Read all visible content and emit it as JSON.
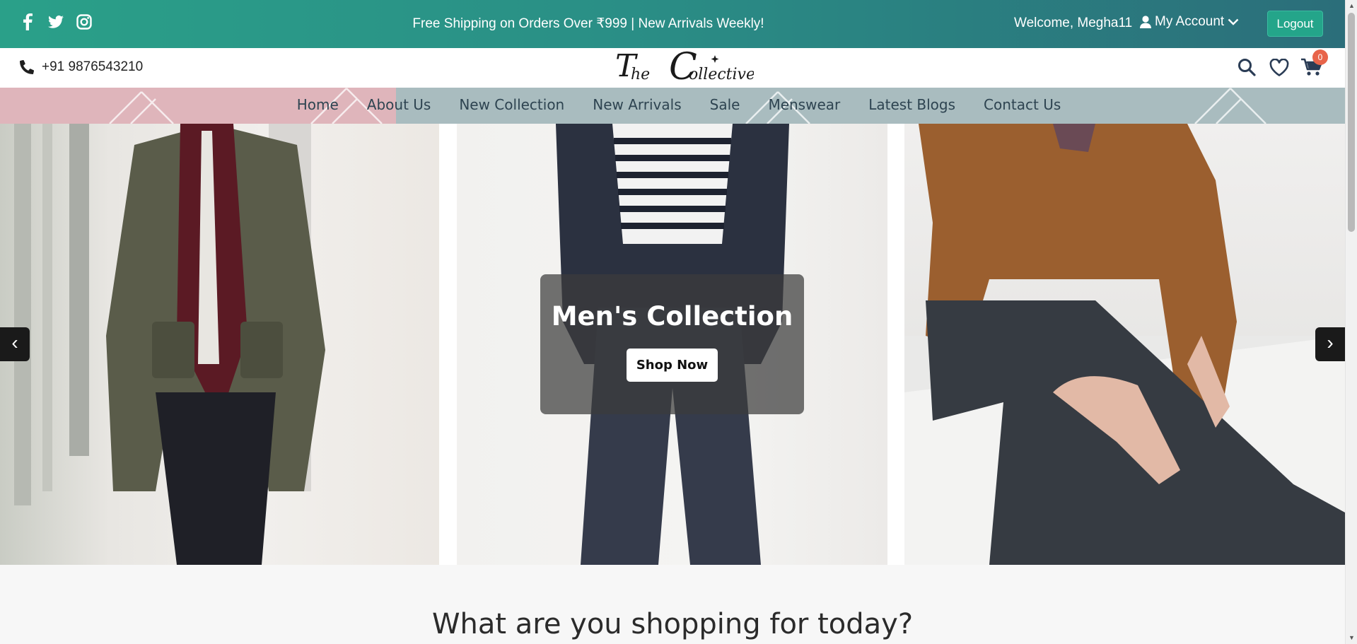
{
  "topbar": {
    "social": [
      "facebook-icon",
      "twitter-icon",
      "instagram-icon"
    ],
    "promo": "Free Shipping on Orders Over ₹999 | New Arrivals Weekly!",
    "welcome": "Welcome, Megha11",
    "account_label": "My Account",
    "logout_label": "Logout",
    "colors": {
      "bar_start": "#2aa089",
      "bar_end": "#2b6e7a",
      "logout_bg": "#24a58a"
    }
  },
  "header": {
    "phone": "+91 9876543210",
    "logo_text": "The Collective",
    "cart_count": "0",
    "icons": [
      "search-icon",
      "heart-icon",
      "cart-icon"
    ]
  },
  "nav": {
    "items": [
      "Home",
      "About Us",
      "New Collection",
      "New Arrivals",
      "Sale",
      "Menswear",
      "Latest Blogs",
      "Contact Us"
    ],
    "colors": {
      "left": "#dfb5bb",
      "right": "#a9bcbf",
      "text": "#2e4451"
    }
  },
  "hero": {
    "title": "Men's Collection",
    "button": "Shop Now",
    "prev_arrow": "‹",
    "next_arrow": "›"
  },
  "section": {
    "title": "What are you shopping for today?"
  }
}
